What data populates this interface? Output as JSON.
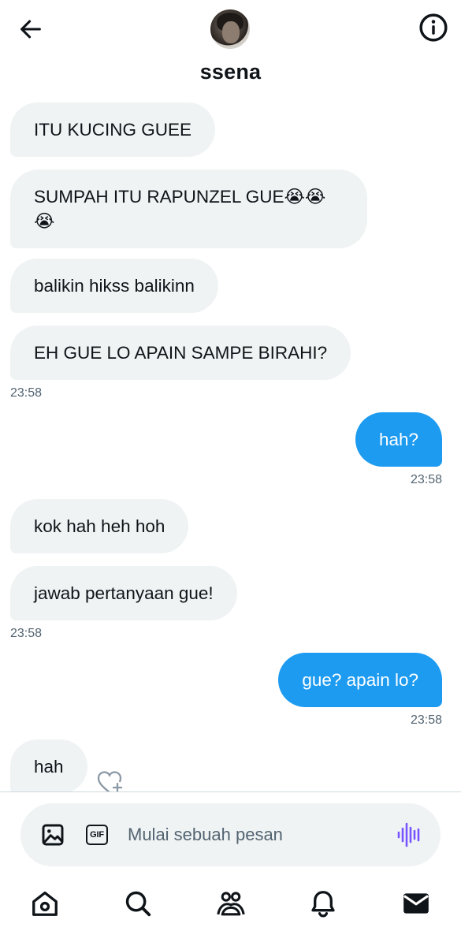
{
  "header": {
    "username": "ssena",
    "back_icon": "arrow-left-icon",
    "info_icon": "info-icon"
  },
  "messages": [
    {
      "direction": "in",
      "text": "ITU KUCING GUEE"
    },
    {
      "direction": "in",
      "text": "SUMPAH ITU RAPUNZEL GUE😭😭😭"
    },
    {
      "direction": "in",
      "text": "balikin hikss balikinn"
    },
    {
      "direction": "in",
      "text": "EH GUE LO APAIN SAMPE BIRAHI?"
    },
    {
      "direction": "out",
      "text": "hah?"
    },
    {
      "direction": "in",
      "text": "kok hah heh hoh"
    },
    {
      "direction": "in",
      "text": "jawab pertanyaan gue!"
    },
    {
      "direction": "out",
      "text": "gue? apain lo?"
    },
    {
      "direction": "in",
      "text": "hah"
    }
  ],
  "timestamps": [
    "23:58",
    "23:58",
    "23:58",
    "23:58"
  ],
  "composer": {
    "placeholder": "Mulai sebuah pesan",
    "gif_label": "GIF",
    "media_icon": "image-icon",
    "voice_icon": "voice-waveform-icon"
  },
  "nav": [
    "home-icon",
    "search-icon",
    "communities-icon",
    "notifications-icon",
    "messages-icon"
  ],
  "colors": {
    "accent": "#1d9bf0",
    "incoming_bubble": "#eff3f4",
    "text": "#0f1419",
    "muted": "#536471",
    "voice": "#7856ff"
  }
}
